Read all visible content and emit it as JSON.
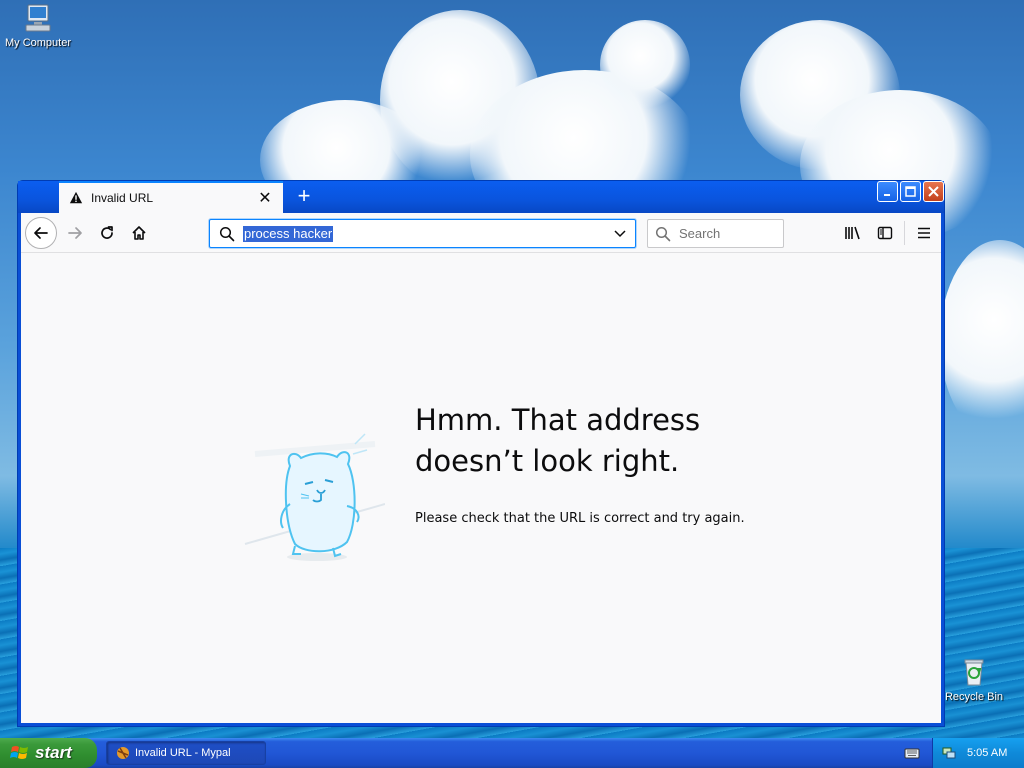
{
  "desktop": {
    "icons": [
      {
        "label": "My Computer",
        "icon": "my-computer-icon"
      },
      {
        "label": "Recycle Bin",
        "icon": "recycle-bin-icon"
      }
    ]
  },
  "browser": {
    "tab": {
      "title": "Invalid URL",
      "icon": "warning-icon"
    },
    "urlbar": {
      "value": "process hacker"
    },
    "searchbar": {
      "placeholder": "Search"
    },
    "error": {
      "title": "Hmm. That address doesn’t look right.",
      "description": "Please check that the URL is correct and try again."
    }
  },
  "taskbar": {
    "start_label": "start",
    "window_button_label": "Invalid URL - Mypal",
    "clock": "5:05 AM"
  },
  "colors": {
    "accent": "#0a84ff",
    "selection": "#3367d6",
    "xp_blue": "#245edb",
    "start_green": "#3b9a3b"
  }
}
